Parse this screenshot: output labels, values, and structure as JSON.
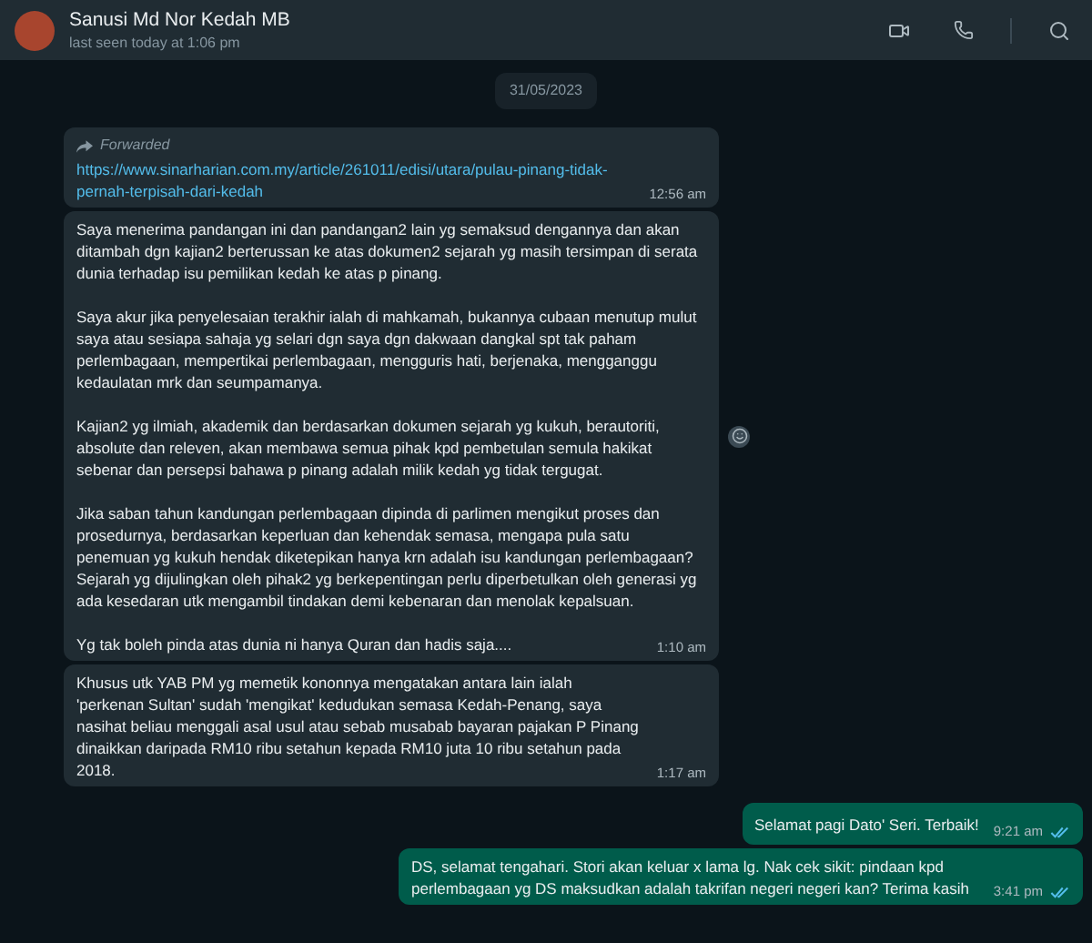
{
  "header": {
    "name": "Sanusi Md Nor Kedah MB",
    "status": "last seen today at 1:06 pm"
  },
  "date": "31/05/2023",
  "messages": [
    {
      "kind": "incoming",
      "forwarded": "Forwarded",
      "link": "https://www.sinarharian.com.my/article/261011/edisi/utara/pulau-pinang-tidak-pernah-terpisah-dari-kedah",
      "time": "12:56 am"
    },
    {
      "kind": "incoming",
      "react": true,
      "paragraphs": [
        "Saya menerima pandangan ini dan pandangan2 lain yg semaksud dengannya dan akan ditambah dgn kajian2 berterussan ke atas dokumen2 sejarah yg masih tersimpan di serata dunia terhadap isu pemilikan kedah ke atas p pinang.",
        "Saya akur jika penyelesaian terakhir ialah di mahkamah, bukannya cubaan menutup mulut saya atau sesiapa sahaja yg selari dgn saya dgn dakwaan dangkal spt tak paham perlembagaan, mempertikai perlembagaan, mengguris hati, berjenaka, mengganggu kedaulatan mrk dan seumpamanya.",
        "Kajian2 yg ilmiah, akademik dan berdasarkan dokumen sejarah yg  kukuh, berautoriti, absolute dan releven, akan membawa semua pihak kpd pembetulan semula hakikat sebenar dan persepsi bahawa p pinang adalah milik kedah yg tidak tergugat.",
        "Jika saban tahun kandungan perlembagaan dipinda di parlimen mengikut proses dan prosedurnya, berdasarkan keperluan dan kehendak semasa, mengapa pula satu penemuan yg kukuh hendak diketepikan hanya krn adalah isu kandungan perlembagaan? Sejarah yg dijulingkan oleh pihak2 yg berkepentingan perlu diperbetulkan oleh generasi yg ada kesedaran utk mengambil tindakan demi kebenaran dan menolak kepalsuan.",
        "Yg tak boleh pinda atas dunia ni hanya Quran dan hadis saja...."
      ],
      "time": "1:10 am"
    },
    {
      "kind": "incoming",
      "paragraphs": [
        "Khusus utk YAB PM yg memetik kononnya mengatakan antara lain ialah 'perkenan Sultan' sudah 'mengikat' kedudukan semasa Kedah-Penang, saya nasihat beliau menggali asal usul atau sebab musabab bayaran pajakan P Pinang dinaikkan daripada RM10 ribu setahun kepada RM10 juta 10 ribu setahun pada 2018."
      ],
      "time": "1:17 am"
    },
    {
      "kind": "outgoing",
      "read": true,
      "paragraphs": [
        "Selamat pagi Dato' Seri. Terbaik!"
      ],
      "time": "9:21 am"
    },
    {
      "kind": "outgoing",
      "read": true,
      "paragraphs": [
        "DS, selamat tengahari. Stori akan keluar x lama lg. Nak cek sikit: pindaan kpd perlembagaan yg DS maksudkan adalah takrifan negeri negeri kan? Terima kasih"
      ],
      "time": "3:41 pm"
    }
  ]
}
